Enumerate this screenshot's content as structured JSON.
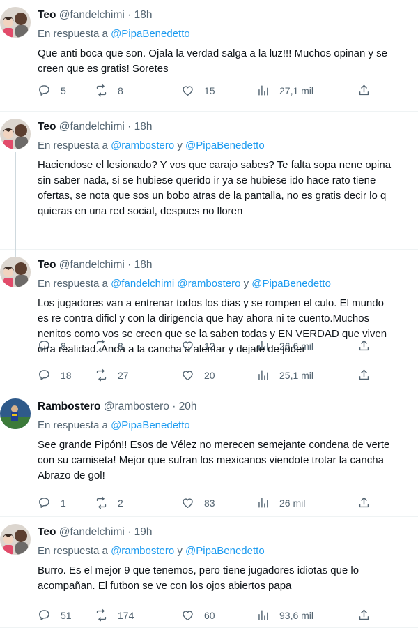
{
  "colors": {
    "link": "#1d9bf0",
    "secondary": "#536471",
    "text": "#0f1419"
  },
  "icons": {
    "reply": "speech-bubble-icon",
    "retweet": "retweet-icon",
    "like": "heart-icon",
    "views": "bar-chart-icon",
    "share": "share-icon"
  },
  "tweets": [
    {
      "name": "Teo",
      "handle": "@fandelchimi",
      "sep": "·",
      "time": "18h",
      "reply_prefix": "En respuesta a",
      "mention1": "@PipaBenedetto",
      "conj": "",
      "mention2": "",
      "lines": [
        "Que anti boca que son. Ojala la verdad salga a la luz!!! Muchos opinan y se",
        "creen que es gratis! Soretes"
      ],
      "replies": "5",
      "retweets": "8",
      "likes": "15",
      "views": "27,1 mil"
    },
    {
      "name": "Teo",
      "handle": "@fandelchimi",
      "sep": "·",
      "time": "18h",
      "reply_prefix": "En respuesta a",
      "mention1": "@rambostero",
      "conj": "y",
      "mention2": "@PipaBenedetto",
      "lines": [
        "Haciendose el lesionado? Y vos que carajo sabes? Te falta sopa nene opina",
        "sin saber nada, si se hubiese querido ir ya se hubiese ido hace rato tiene",
        "ofertas, se nota que sos un bobo atras de la pantalla, no es gratis decir lo q",
        "quieras en una red social, despues no lloren"
      ],
      "replies": "8",
      "retweets": "8",
      "likes": "12",
      "views": "26,6 mil"
    },
    {
      "name": "Teo",
      "handle": "@fandelchimi",
      "sep": "·",
      "time": "18h",
      "reply_prefix": "En respuesta a",
      "mention1": "@fandelchimi @rambostero",
      "conj": "y",
      "mention2": "@PipaBenedetto",
      "lines": [
        "Los jugadores van a entrenar todos los dias y se rompen el culo. El mundo",
        "es re contra dificl y con la dirigencia que hay ahora ni te cuento.Muchos",
        "nenitos como vos se creen que se la saben todas y EN VERDAD que viven",
        "otra realidad. Anda a la cancha a alentar y dejate de joder"
      ],
      "replies": "18",
      "retweets": "27",
      "likes": "20",
      "views": "25,1 mil"
    },
    {
      "name": "Rambostero",
      "handle": "@rambostero",
      "sep": "·",
      "time": "20h",
      "reply_prefix": "En respuesta a",
      "mention1": "@PipaBenedetto",
      "conj": "",
      "mention2": "",
      "lines": [
        "See grande Pipón!! Esos de Vélez no merecen semejante condena de verte",
        "con su camiseta! Mejor que sufran los mexicanos viendote trotar la cancha",
        "Abrazo de gol!"
      ],
      "replies": "1",
      "retweets": "2",
      "likes": "83",
      "views": "26 mil"
    },
    {
      "name": "Teo",
      "handle": "@fandelchimi",
      "sep": "·",
      "time": "19h",
      "reply_prefix": "En respuesta a",
      "mention1": "@rambostero",
      "conj": "y",
      "mention2": "@PipaBenedetto",
      "lines": [
        "Burro. Es el mejor 9 que tenemos, pero tiene jugadores idiotas que lo",
        "acompañan. El futbon se ve con los ojos abiertos papa"
      ],
      "replies": "51",
      "retweets": "174",
      "likes": "60",
      "views": "93,6 mil"
    }
  ]
}
